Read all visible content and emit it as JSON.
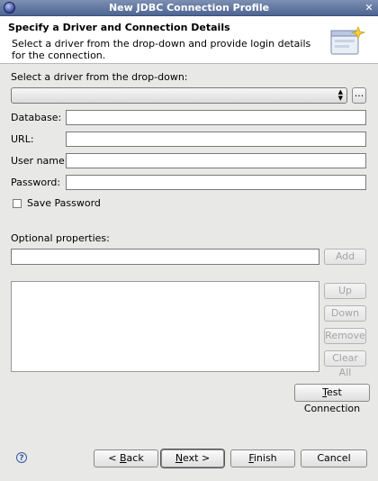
{
  "window": {
    "title": "New JDBC Connection Profile"
  },
  "header": {
    "title": "Specify a Driver and Connection Details",
    "description": "Select a driver from the drop-down and provide login details for the connection."
  },
  "driver": {
    "label": "Select a driver from the drop-down:",
    "selected": "",
    "browse_label": "..."
  },
  "fields": {
    "database": {
      "label": "Database:",
      "value": ""
    },
    "url": {
      "label": "URL:",
      "value": ""
    },
    "username": {
      "label": "User name:",
      "value": ""
    },
    "password": {
      "label": "Password:",
      "value": ""
    }
  },
  "save_password": {
    "label": "Save Password",
    "checked": false
  },
  "optional": {
    "label": "Optional properties:",
    "value": "",
    "add_label": "Add",
    "up_label": "Up",
    "down_label": "Down",
    "remove_label": "Remove",
    "clear_all_label": "Clear All"
  },
  "test_connection": {
    "first": "T",
    "rest": "est Connection"
  },
  "footer": {
    "back": {
      "prefix": "< ",
      "mnemonic": "B",
      "rest": "ack"
    },
    "next": {
      "mnemonic": "N",
      "rest": "ext >"
    },
    "finish": {
      "mnemonic": "F",
      "rest": "inish"
    },
    "cancel_label": "Cancel"
  },
  "colors": {
    "title_bar": "#5a6f9c",
    "dialog_bg": "#e8e8e7",
    "header_bg": "#ffffff"
  }
}
